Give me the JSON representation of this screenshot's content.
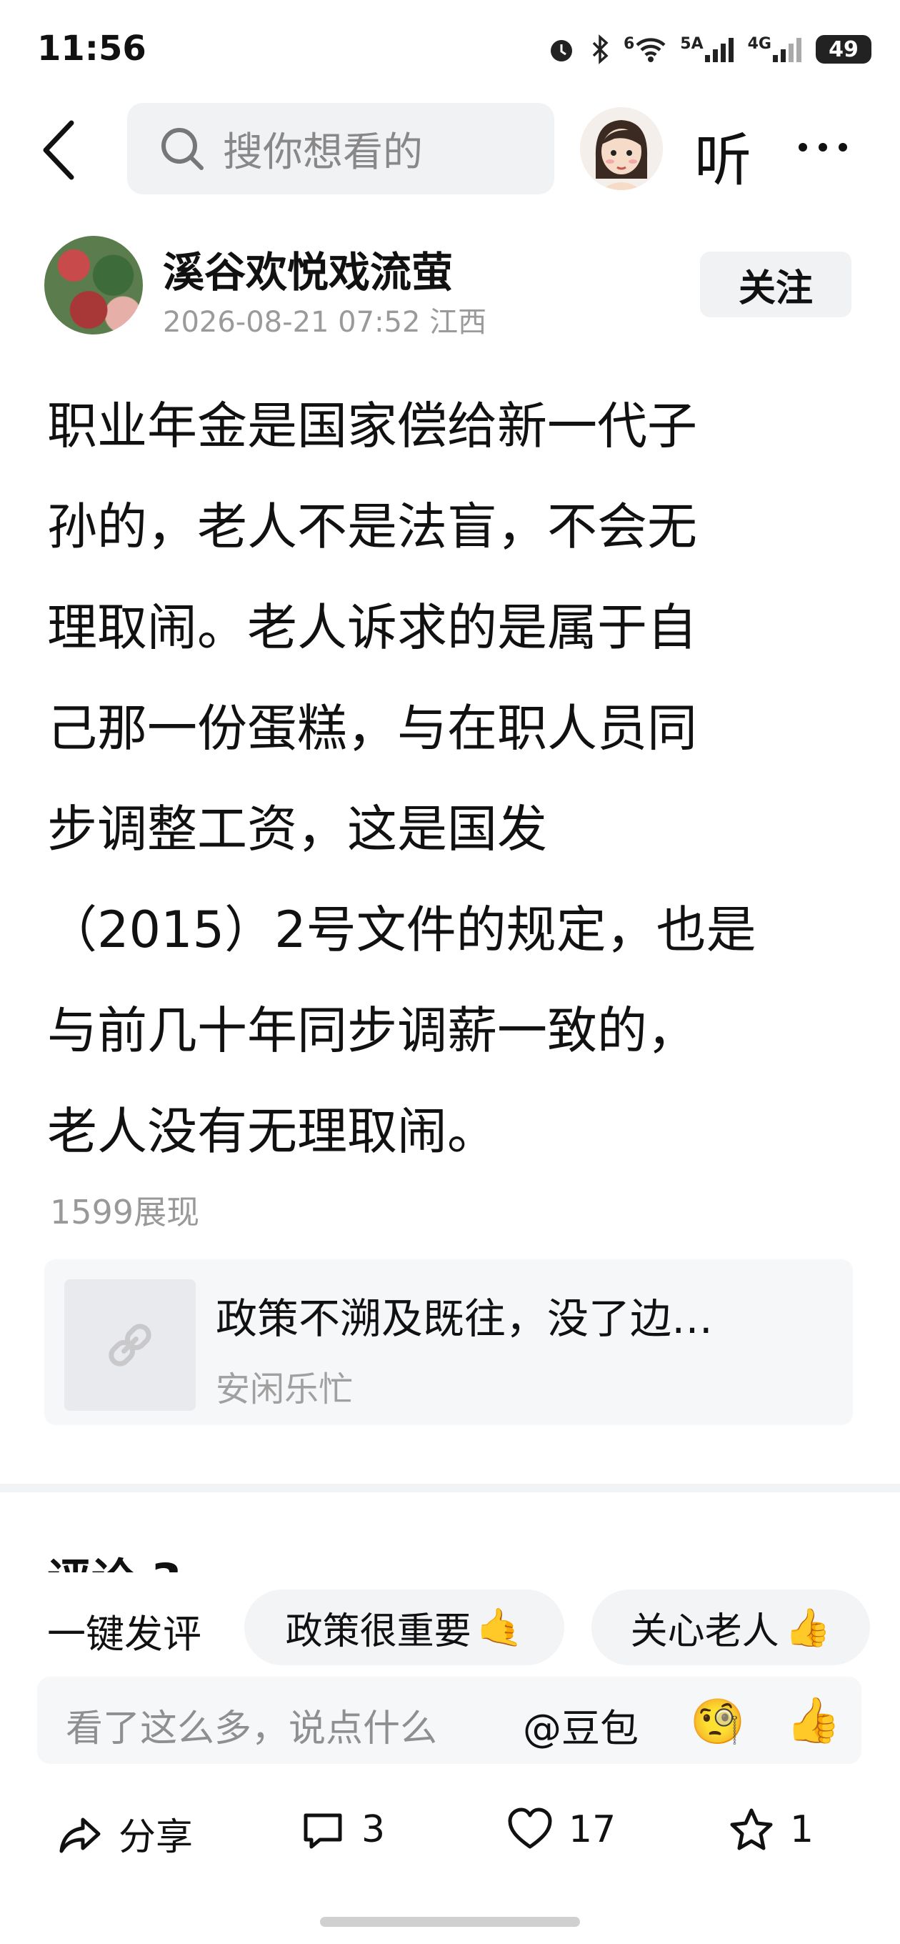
{
  "status_bar": {
    "time": "11:56",
    "wifi_label": "6",
    "sim1_label": "5A",
    "sim2_label": "4G",
    "battery": "49"
  },
  "nav": {
    "search_placeholder": "搜你想看的",
    "listen_label": "听"
  },
  "post": {
    "author_name": "溪谷欢悦戏流萤",
    "meta": "2026-08-21 07:52 江西",
    "follow_label": "关注",
    "body_lines": [
      "职业年金是国家偿给新一代子",
      "孙的，老人不是法盲，不会无",
      "理取闹。老人诉求的是属于自",
      "己那一份蛋糕，与在职人员同",
      "步调整工资，这是国发",
      "（2015）2号文件的规定，也是",
      "与前几十年同步调薪一致的，",
      "老人没有无理取闹。"
    ],
    "view_count": "1599展现"
  },
  "link_card": {
    "title": "政策不溯及既往，没了边…",
    "source": "安闲乐忙"
  },
  "comments": {
    "title": "评论 3"
  },
  "quick_comment": {
    "label": "一键发评",
    "chips": [
      {
        "text": "政策很重要",
        "emoji": "🤙"
      },
      {
        "text": "关心老人",
        "emoji": "👍"
      }
    ]
  },
  "comment_input": {
    "placeholder": "看了这么多，说点什么",
    "mention": "@豆包",
    "emoji_1": "🧐",
    "emoji_2": "👍"
  },
  "bottom_bar": {
    "share_label": "分享",
    "comment_count": "3",
    "like_count": "17",
    "favorite_count": "1"
  }
}
